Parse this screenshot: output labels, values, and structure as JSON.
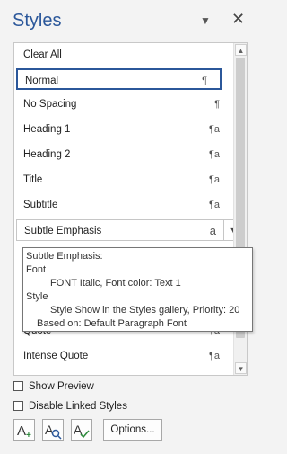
{
  "pane": {
    "title": "Styles",
    "menu_icon": "chevron-down-icon",
    "close_icon": "close-icon"
  },
  "styles": {
    "clear_all": "Clear All",
    "items": [
      {
        "label": "Normal",
        "mark": "¶"
      },
      {
        "label": "No Spacing",
        "mark": "¶"
      },
      {
        "label": "Heading 1",
        "mark": "¶a"
      },
      {
        "label": "Heading 2",
        "mark": "¶a"
      },
      {
        "label": "Title",
        "mark": "¶a"
      },
      {
        "label": "Subtitle",
        "mark": "¶a"
      },
      {
        "label": "Subtle Emphasis",
        "mark": "a"
      },
      {
        "label": "Quote",
        "mark": "¶a"
      },
      {
        "label": "Intense Quote",
        "mark": "¶a"
      }
    ]
  },
  "tooltip": {
    "line1": "Subtle Emphasis:",
    "line2": "Font",
    "line3": "FONT  Italic, Font color: Text 1",
    "line4": "Style",
    "line5": "Style Show in the Styles gallery, Priority: 20",
    "line6": "Based on: Default Paragraph Font"
  },
  "options": {
    "show_preview": "Show Preview",
    "disable_linked": "Disable Linked Styles",
    "options_button": "Options..."
  },
  "toolbar_icons": [
    "new-style-icon",
    "style-inspector-icon",
    "manage-styles-icon"
  ],
  "colors": {
    "accent": "#2b579a",
    "panel_bg": "#f3f3f3"
  }
}
